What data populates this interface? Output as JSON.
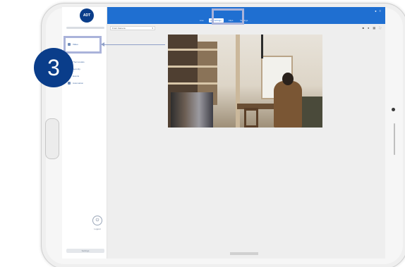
{
  "callout": {
    "step_number": "3"
  },
  "app": {
    "logo_text": "ADT",
    "header_title": "",
    "tabs": [
      {
        "label": "Live",
        "selected": false
      },
      {
        "label": "Recordings",
        "selected": true
      },
      {
        "label": "Clips",
        "selected": false
      },
      {
        "label": "Settings",
        "selected": false
      }
    ]
  },
  "sidebar": {
    "items": [
      {
        "label": "Video",
        "icon": "video-icon"
      },
      {
        "label": "Thermostats",
        "icon": "thermostat-icon"
      },
      {
        "label": "Security",
        "icon": "shield-icon"
      },
      {
        "label": "Events",
        "icon": "bell-icon"
      },
      {
        "label": "Automation",
        "icon": "gear-icon"
      }
    ],
    "exit_label": "Logout",
    "footer_text": "Settings"
  },
  "toolbar": {
    "camera_select_value": "Front Camera"
  },
  "colors": {
    "brand_blue": "#1f6fd1",
    "callout_navy": "#0a3d8a",
    "highlight": "#aab3da"
  }
}
